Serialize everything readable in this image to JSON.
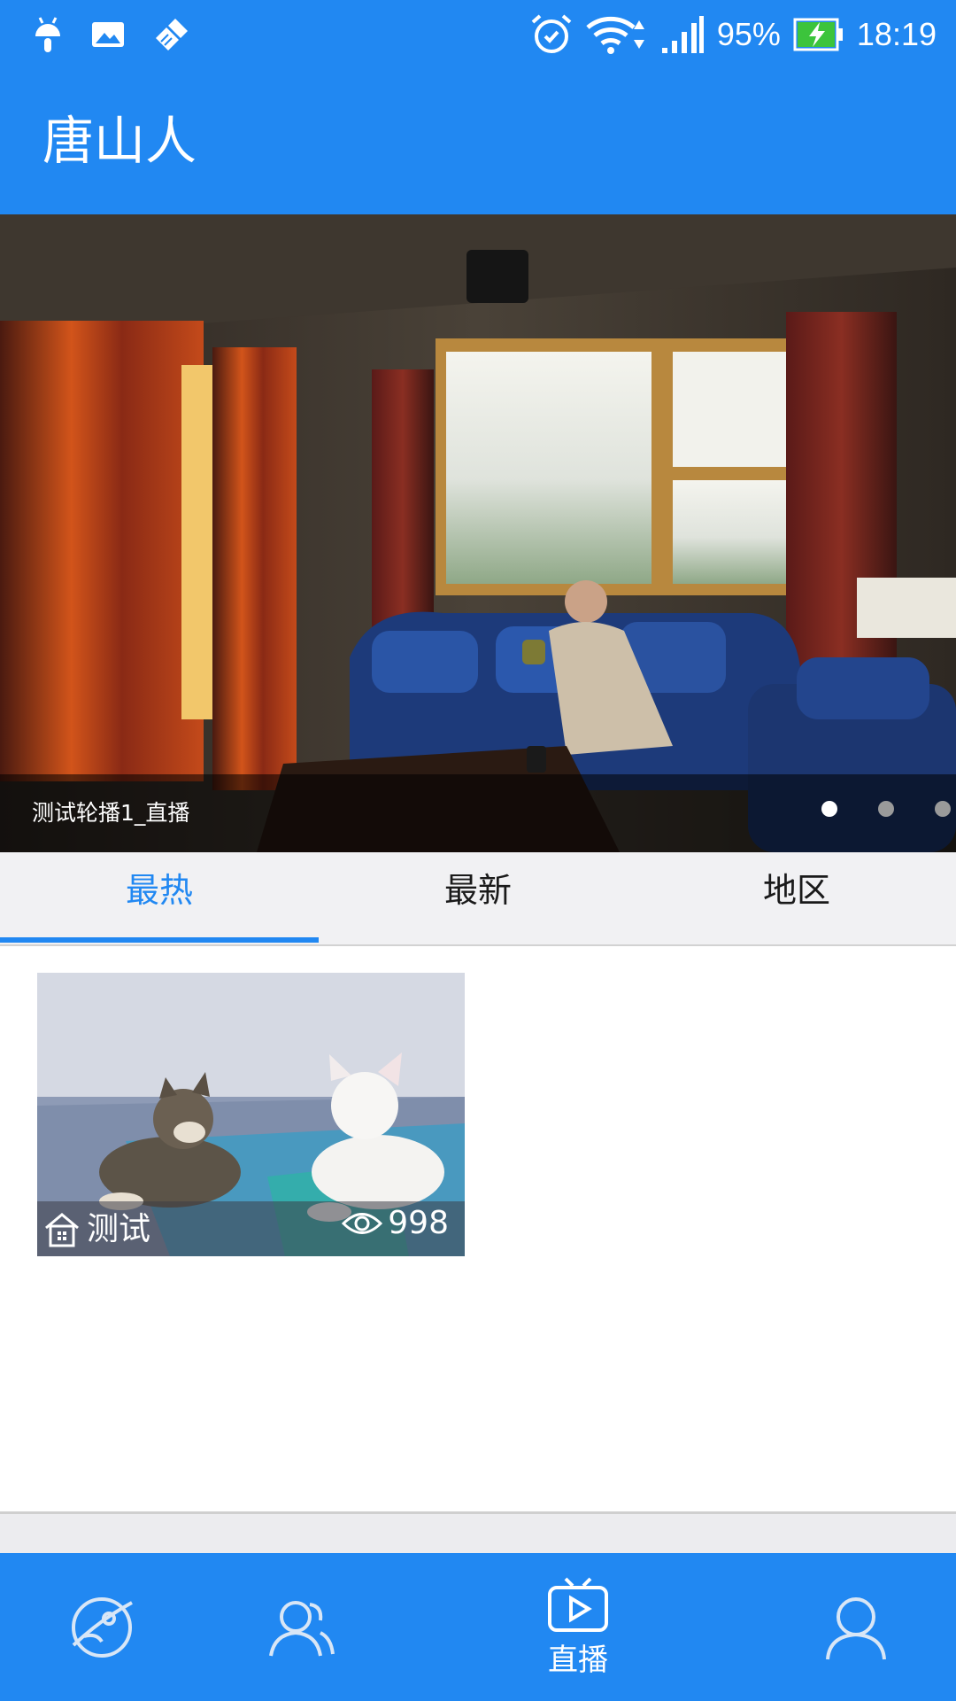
{
  "status_bar": {
    "battery": "95%",
    "time": "18:19",
    "icons": [
      "android-icon",
      "image-icon",
      "broom-icon",
      "alarm-icon",
      "wifi-icon",
      "signal-icon",
      "battery-charging-icon"
    ]
  },
  "app_bar": {
    "title": "唐山人"
  },
  "banner": {
    "caption": "测试轮播1_直播",
    "page_count": 3,
    "active_page": 1
  },
  "tabs": [
    {
      "label": "最热",
      "active": true
    },
    {
      "label": "最新",
      "active": false
    },
    {
      "label": "地区",
      "active": false
    }
  ],
  "live_cards": [
    {
      "title": "测试",
      "viewers": "998",
      "icons": [
        "home-icon",
        "eye-icon"
      ]
    }
  ],
  "bottom_nav": [
    {
      "icon": "planet-icon",
      "label": ""
    },
    {
      "icon": "users-icon",
      "label": ""
    },
    {
      "icon": "tv-play-icon",
      "label": "直播",
      "active": true
    },
    {
      "icon": "person-icon",
      "label": ""
    }
  ],
  "colors": {
    "primary": "#2188f2",
    "tab_bar_bg": "#f1f1f3",
    "divider": "#cfcfcf"
  }
}
